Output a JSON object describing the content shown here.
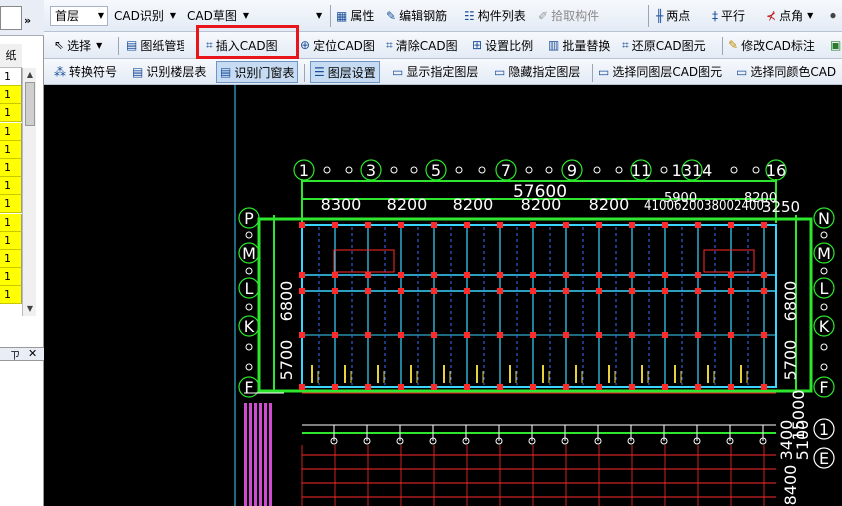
{
  "left_panel": {
    "header_label": "纸",
    "more_label": "»",
    "rows": [
      "1",
      "1",
      "1",
      "1",
      "1",
      "1",
      "1",
      "1",
      "1",
      "1",
      "1",
      "1",
      "1"
    ],
    "row_color": "#ffff00",
    "pin_label": "ㄗ",
    "close_label": "✕"
  },
  "toolbar1": {
    "floor_combo": "首层",
    "cad_recognize": "CAD识别",
    "cad_sketch": "CAD草图",
    "properties": "属性",
    "edit_rebar": "编辑钢筋",
    "component_list": "构件列表",
    "pick_component": "拾取构件",
    "two_points": "两点",
    "parallel": "平行",
    "point_angle": "点角"
  },
  "toolbar2": {
    "select": "选择",
    "drawing_manage": "图纸管理",
    "insert_cad": "插入CAD图",
    "locate_cad": "定位CAD图",
    "clear_cad": "清除CAD图",
    "set_scale": "设置比例",
    "batch_replace": "批量替换",
    "restore_cad": "还原CAD图元",
    "modify_cad_label": "修改CAD标注"
  },
  "toolbar3": {
    "convert_symbol": "转换符号",
    "recognize_floor_table": "识别楼层表",
    "recognize_door_window_table": "识别门窗表",
    "layer_settings": "图层设置",
    "show_layer": "显示指定图层",
    "hide_layer": "隐藏指定图层",
    "select_same_layer": "选择同图层CAD图元",
    "select_same_color": "选择同颜色CAD"
  },
  "drawing": {
    "axis_numbers_top": [
      "1",
      "3",
      "5",
      "7",
      "9",
      "11",
      "1314",
      "16"
    ],
    "axis_letters_left": [
      "P",
      "M",
      "L",
      "K",
      "F"
    ],
    "axis_letters_right": [
      "N",
      "M",
      "L",
      "K",
      "F",
      "1",
      "E"
    ],
    "total_dim": "57600",
    "bay_dims": [
      "8300",
      "8200",
      "8200",
      "8200",
      "8200"
    ],
    "right_bay_dims": "4100620038002400",
    "right_bay_top": "5900",
    "right_bay_top2": "8200",
    "right_bay_end": "3250",
    "side_dims_left_1": "6800",
    "side_dims_left_2": "5700",
    "side_dims_right_1": "6800",
    "side_dims_right_2": "5700",
    "bottom_right_dims": "8400",
    "bottom_right_dims2": "3400",
    "bottom_right_dims3": "15000",
    "bottom_right_dims4": "5100"
  }
}
